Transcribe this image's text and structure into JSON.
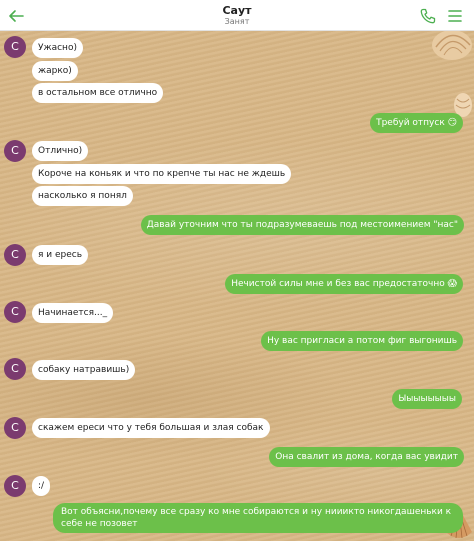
{
  "header": {
    "title": "Саут",
    "status": "Занят"
  },
  "colors": {
    "accent": "#4caf50",
    "outgoing_bubble": "#6cc04a",
    "incoming_bubble": "#ffffff",
    "avatar": "#7b3b6f"
  },
  "avatar_letter": "С",
  "messages": [
    {
      "dir": "in",
      "text": "Ужасно)"
    },
    {
      "dir": "in",
      "text": "жарко)"
    },
    {
      "dir": "in",
      "text": "в остальном все отлично"
    },
    {
      "dir": "out",
      "text": "Требуй отпуск 😏"
    },
    {
      "dir": "in",
      "text": "Отлично)"
    },
    {
      "dir": "in",
      "text": "Короче на коньяк и что по крепче ты нас не ждешь"
    },
    {
      "dir": "in",
      "text": "насколько я понял"
    },
    {
      "dir": "out",
      "text": "Давай уточним что ты подразумеваешь под местоимением \"нас\""
    },
    {
      "dir": "in",
      "text": "я и ересь"
    },
    {
      "dir": "out",
      "text": "Нечистой силы мне и без вас предостаточно 😱"
    },
    {
      "dir": "in",
      "text": "Начинается..._"
    },
    {
      "dir": "out",
      "text": "Ну вас пригласи а потом фиг выгонишь"
    },
    {
      "dir": "in",
      "text": "собаку натравишь)"
    },
    {
      "dir": "out",
      "text": "Ыыыыыыыы"
    },
    {
      "dir": "in",
      "text": "скажем ереси что у тебя большая и злая собак"
    },
    {
      "dir": "out",
      "text": "Она свалит из дома, когда вас увидит"
    },
    {
      "dir": "in",
      "text": ":/"
    },
    {
      "dir": "out",
      "text": "Вот объясни,почему все сразу ко мне собираются и ну нииикто никогдашеньки к себе не позовет"
    }
  ]
}
